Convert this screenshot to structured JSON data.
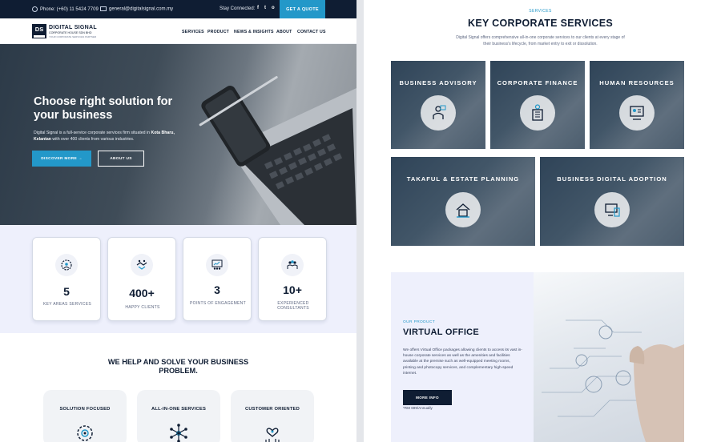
{
  "topbar": {
    "phone": "Phone: (+60) 11 5424 7709",
    "email": "general@digitalsignal.com.my",
    "stay_connected": "Stay Connected",
    "social": [
      "f",
      "t",
      "o"
    ],
    "quote_button": "GET A QUOTE"
  },
  "logo": {
    "mark": "DS",
    "name": "DIGITAL SIGNAL",
    "subtitle": "CORPORATE HOUSE SDN BHD",
    "tagline": "YOUR CORPORATE SERVICES PARTNER"
  },
  "nav": [
    "SERVICES",
    "PRODUCT",
    "NEWS & INSIGHTS",
    "ABOUT",
    "CONTACT US"
  ],
  "hero": {
    "title": "Choose right solution for your business",
    "desc_prefix": "Digital Signal is a full-service corporate services firm situated in",
    "desc_location": "Kota Bharu, Kelantan",
    "desc_suffix": "with over 400 clients from various industries.",
    "primary_button": "DISCOVER MORE →",
    "secondary_button": "ABOUT US"
  },
  "stats": [
    {
      "value": "5",
      "label": "KEY AREAS SERVICES",
      "icon": "settings-people-icon"
    },
    {
      "value": "400+",
      "label": "HAPPY CLIENTS",
      "icon": "handshake-icon"
    },
    {
      "value": "3",
      "label": "POINTS OF ENGAGEMENT",
      "icon": "presentation-icon"
    },
    {
      "value": "10+",
      "label": "EXPERIENCED CONSULTANTS",
      "icon": "team-icon"
    }
  ],
  "help": {
    "title": "WE HELP AND SOLVE YOUR BUSINESS PROBLEM.",
    "features": [
      {
        "label": "SOLUTION FOCUSED",
        "icon": "gear-target-icon"
      },
      {
        "label": "ALL-IN-ONE SERVICES",
        "icon": "network-icon"
      },
      {
        "label": "CUSTOMER ORIENTED",
        "icon": "heart-people-icon"
      }
    ]
  },
  "services": {
    "eyebrow": "SERVICES",
    "title": "KEY CORPORATE SERVICES",
    "desc": "Digital Signal offers comprehensive all-in-one corporate services to our clients at every stage of their business's lifecycle, from market entry to exit or dissolution.",
    "items": [
      {
        "label": "BUSINESS ADVISORY",
        "icon": "advisor-icon"
      },
      {
        "label": "CORPORATE FINANCE",
        "icon": "finance-building-icon"
      },
      {
        "label": "HUMAN RESOURCES",
        "icon": "hr-profile-icon"
      },
      {
        "label": "TAKAFUL & ESTATE PLANNING",
        "icon": "estate-house-icon"
      },
      {
        "label": "BUSINESS DIGITAL ADOPTION",
        "icon": "digital-devices-icon"
      }
    ]
  },
  "virtual_office": {
    "eyebrow": "OUR PRODUCT",
    "title": "VIRTUAL OFFICE",
    "desc": "We offers Virtual Office packages allowing clients to access its vast in-house corporate services as well as the amenities and facilities available at the premise such as well-equipped meeting rooms, printing and photocopy services, and complementary high-speed internet.",
    "button": "MORE INFO",
    "price": "*RM 699/Annually"
  },
  "colors": {
    "navy": "#0f1d33",
    "accent": "#2398c9",
    "light_bg": "#eef0fc"
  }
}
